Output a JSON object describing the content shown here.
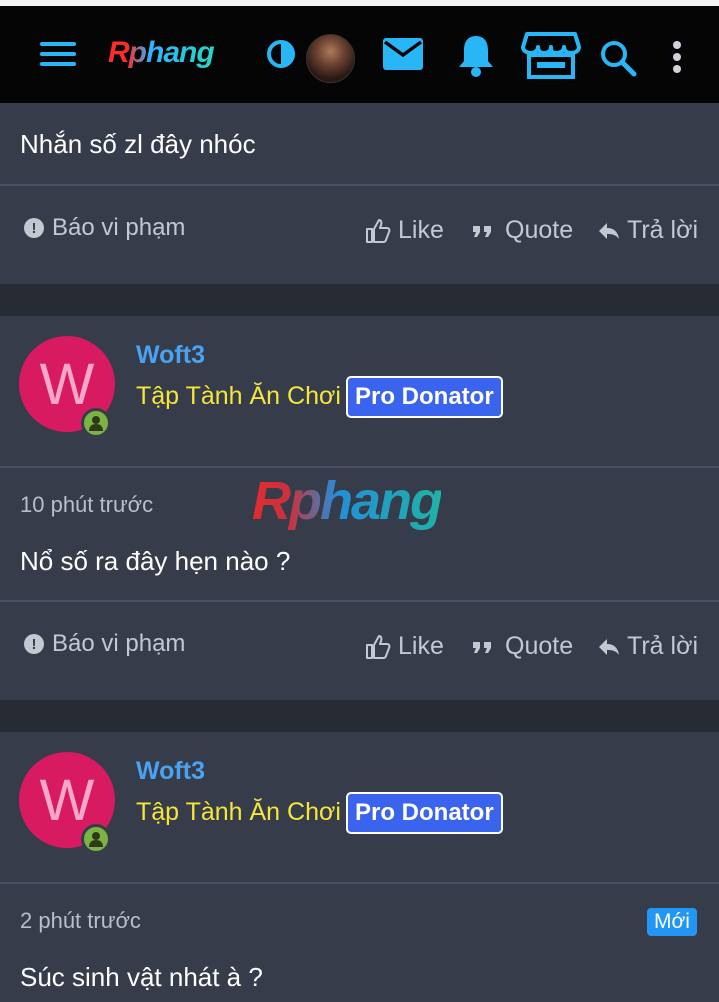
{
  "header": {
    "logo_text": "Rphang",
    "icons": [
      "menu-icon",
      "theme-toggle-icon",
      "user-avatar",
      "mail-icon",
      "bell-icon",
      "store-icon",
      "search-icon",
      "more-vert-icon"
    ],
    "accent_color": "#29b6f6"
  },
  "post1": {
    "content": "Nhắn số zl đây nhóc",
    "actions": {
      "report": "Báo vi phạm",
      "like": "Like",
      "quote": "Quote",
      "reply": "Trả lời"
    }
  },
  "post2": {
    "user": {
      "initial": "W",
      "name": "Woft3",
      "title": "Tập Tành Ăn Chơi",
      "badge": "Pro Donator"
    },
    "time": "10 phút trước",
    "content": "Nổ số ra đây hẹn nào ?",
    "actions": {
      "report": "Báo vi phạm",
      "like": "Like",
      "quote": "Quote",
      "reply": "Trả lời"
    }
  },
  "post3": {
    "user": {
      "initial": "W",
      "name": "Woft3",
      "title": "Tập Tành Ăn Chơi",
      "badge": "Pro Donator"
    },
    "time": "2 phút trước",
    "new_badge": "Mới",
    "content": "Súc sinh vật nhát à ?"
  },
  "watermark": "Rphang"
}
